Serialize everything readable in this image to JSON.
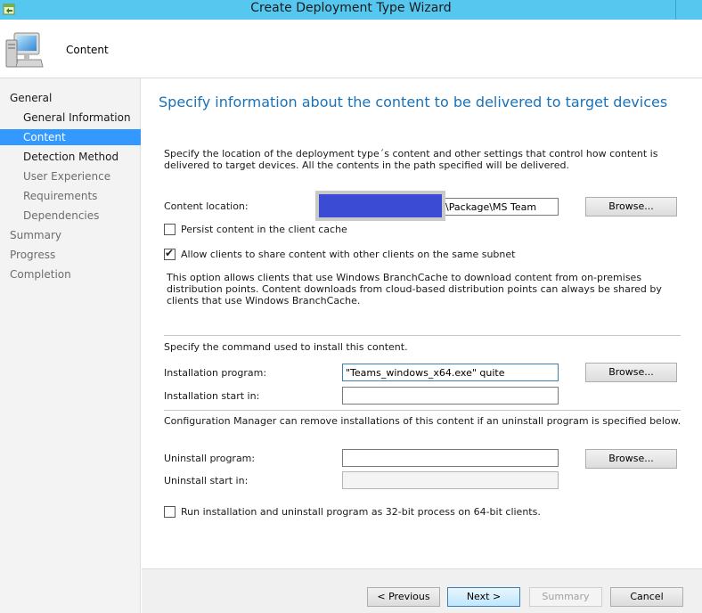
{
  "window": {
    "title": "Create Deployment Type Wizard"
  },
  "header": {
    "title": "Content"
  },
  "sidebar": {
    "items": [
      {
        "label": "General"
      },
      {
        "label": "General Information"
      },
      {
        "label": "Content"
      },
      {
        "label": "Detection Method"
      },
      {
        "label": "User Experience"
      },
      {
        "label": "Requirements"
      },
      {
        "label": "Dependencies"
      },
      {
        "label": "Summary"
      },
      {
        "label": "Progress"
      },
      {
        "label": "Completion"
      }
    ]
  },
  "main": {
    "heading": "Specify information about the content to be delivered to target devices",
    "description": "Specify the location of the deployment type´s content and other settings that control how content is delivered to target devices. All the contents in the path specified will be delivered.",
    "content_location": {
      "label": "Content location:",
      "value": "\\Package\\MS Team",
      "browse": "Browse..."
    },
    "persist": {
      "label": "Persist content in the client cache",
      "checked": false
    },
    "share": {
      "label": "Allow clients to share content with other clients on the same subnet",
      "checked": true
    },
    "branchcache_note": "This option allows clients that use Windows BranchCache to download content from on-premises distribution points. Content downloads from cloud-based distribution points can always be shared by clients that use Windows BranchCache.",
    "install_section": "Specify the command used to install this content.",
    "install_program": {
      "label": "Installation program:",
      "value": "\"Teams_windows_x64.exe\" quite",
      "browse": "Browse..."
    },
    "install_start": {
      "label": "Installation start in:",
      "value": ""
    },
    "uninstall_section": "Configuration Manager can remove installations of this content if an uninstall program is specified below.",
    "uninstall_program": {
      "label": "Uninstall program:",
      "value": "",
      "browse": "Browse..."
    },
    "uninstall_start": {
      "label": "Uninstall start in:",
      "value": ""
    },
    "run32": {
      "label": "Run installation and uninstall program as 32-bit process on 64-bit clients.",
      "checked": false
    }
  },
  "footer": {
    "previous": "< Previous",
    "next": "Next >",
    "summary": "Summary",
    "cancel": "Cancel"
  }
}
